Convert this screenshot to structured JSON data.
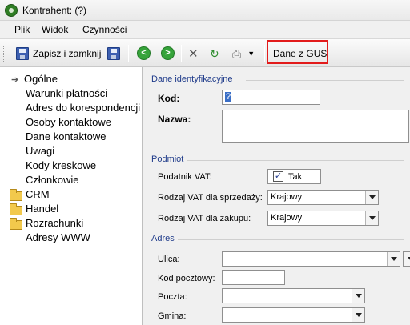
{
  "window": {
    "title": "Kontrahent: (?)"
  },
  "menu": {
    "items": [
      "Plik",
      "Widok",
      "Czynności"
    ]
  },
  "toolbar": {
    "save_close_label": "Zapisz i zamknij",
    "gus_label": "Dane z GUS"
  },
  "sidebar": {
    "items": [
      "Ogólne",
      "Warunki płatności",
      "Adres do korespondencji",
      "Osoby kontaktowe",
      "Dane kontaktowe",
      "Uwagi",
      "Kody kreskowe",
      "Członkowie"
    ],
    "folders": [
      "CRM",
      "Handel",
      "Rozrachunki"
    ],
    "last_item": "Adresy WWW"
  },
  "ident": {
    "title": "Dane identyfikacyjne",
    "kod_label": "Kod:",
    "kod_value": "?",
    "nazwa_label": "Nazwa:",
    "nazwa_value": ""
  },
  "podmiot": {
    "title": "Podmiot",
    "vat_label": "Podatnik VAT:",
    "vat_checked": true,
    "vat_value": "Tak",
    "sale_label": "Rodzaj VAT dla sprzedaży:",
    "sale_value": "Krajowy",
    "purchase_label": "Rodzaj VAT dla zakupu:",
    "purchase_value": "Krajowy"
  },
  "adres": {
    "title": "Adres",
    "street_label": "Ulica:",
    "street_value": "",
    "postal_label": "Kod pocztowy:",
    "postal_value": "",
    "post_label": "Poczta:",
    "post_value": "",
    "commune_label": "Gmina:",
    "commune_value": ""
  }
}
